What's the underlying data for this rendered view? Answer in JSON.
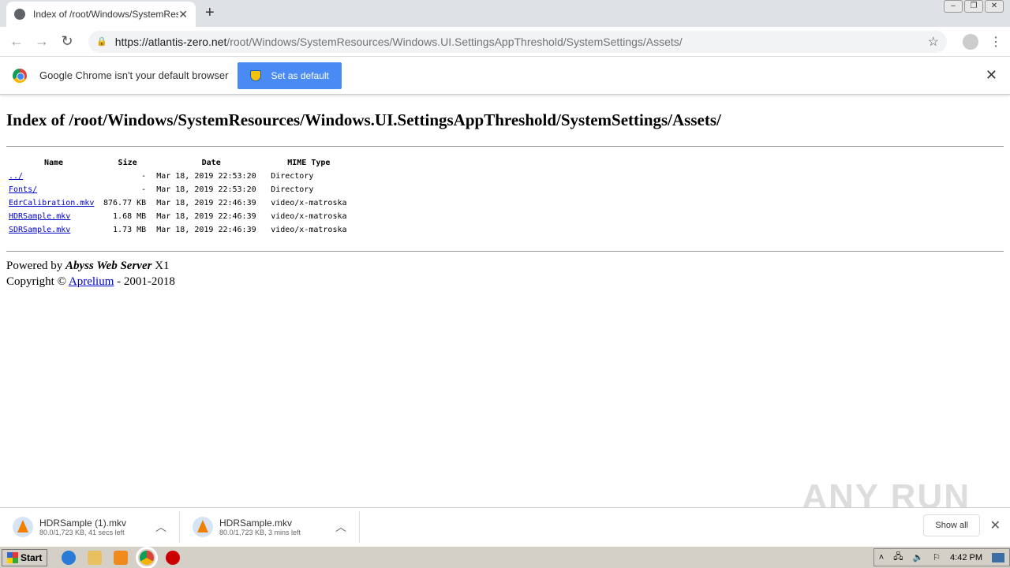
{
  "browser": {
    "tab_title": "Index of /root/Windows/SystemResources/Windows.UI.SettingsAppThreshold/SystemSettings/Assets/",
    "url_host": "https://atlantis-zero.net",
    "url_path": "/root/Windows/SystemResources/Windows.UI.SettingsAppThreshold/SystemSettings/Assets/"
  },
  "infobar": {
    "message": "Google Chrome isn't your default browser",
    "button": "Set as default"
  },
  "page": {
    "title": "Index of /root/Windows/SystemResources/Windows.UI.SettingsAppThreshold/SystemSettings/Assets/",
    "columns": [
      "Name",
      "Size",
      "Date",
      "MIME Type"
    ],
    "rows": [
      {
        "name": "../",
        "size": "-",
        "date": "Mar 18, 2019 22:53:20",
        "type": "Directory"
      },
      {
        "name": "Fonts/",
        "size": "-",
        "date": "Mar 18, 2019 22:53:20",
        "type": "Directory"
      },
      {
        "name": "EdrCalibration.mkv",
        "size": "876.77 KB",
        "date": "Mar 18, 2019 22:46:39",
        "type": "video/x-matroska"
      },
      {
        "name": "HDRSample.mkv",
        "size": "1.68 MB",
        "date": "Mar 18, 2019 22:46:39",
        "type": "video/x-matroska"
      },
      {
        "name": "SDRSample.mkv",
        "size": "1.73 MB",
        "date": "Mar 18, 2019 22:46:39",
        "type": "video/x-matroska"
      }
    ],
    "powered_prefix": "Powered by ",
    "server": "Abyss Web Server",
    "server_suffix": " X1",
    "copyright_prefix": "Copyright © ",
    "company": "Aprelium",
    "copyright_suffix": " - 2001-2018"
  },
  "downloads": {
    "items": [
      {
        "name": "HDRSample (1).mkv",
        "status": "80.0/1,723 KB, 41 secs left"
      },
      {
        "name": "HDRSample.mkv",
        "status": "80.0/1,723 KB, 3 mins left"
      }
    ],
    "show_all": "Show all"
  },
  "watermark": "ANY RUN",
  "taskbar": {
    "start": "Start",
    "clock": "4:42 PM"
  }
}
